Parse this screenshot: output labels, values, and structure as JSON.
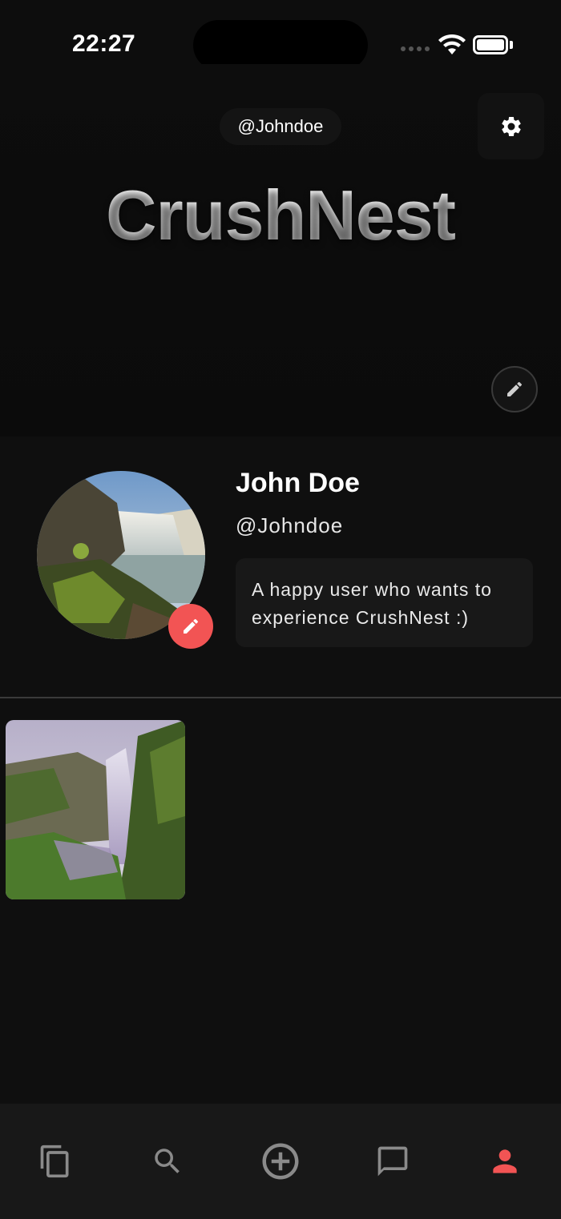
{
  "status": {
    "time": "22:27"
  },
  "header": {
    "handle": "@Johndoe",
    "brand": "CrushNest"
  },
  "profile": {
    "name": "John Doe",
    "username": "@Johndoe",
    "bio": "A happy user who wants to experience CrushNest :)"
  },
  "icons": {
    "settings": "gear-icon",
    "cover_edit": "pencil-icon",
    "avatar_edit": "pencil-icon"
  },
  "nav": [
    {
      "id": "feed",
      "icon": "cards-stack-icon",
      "active": false
    },
    {
      "id": "search",
      "icon": "search-icon",
      "active": false
    },
    {
      "id": "create",
      "icon": "plus-circle-icon",
      "active": false
    },
    {
      "id": "messages",
      "icon": "chat-bubble-icon",
      "active": false
    },
    {
      "id": "profile",
      "icon": "person-icon",
      "active": true
    }
  ],
  "colors": {
    "accent": "#f25454",
    "inactive_icon": "#8a8a8a",
    "background": "#0f0f0f"
  }
}
